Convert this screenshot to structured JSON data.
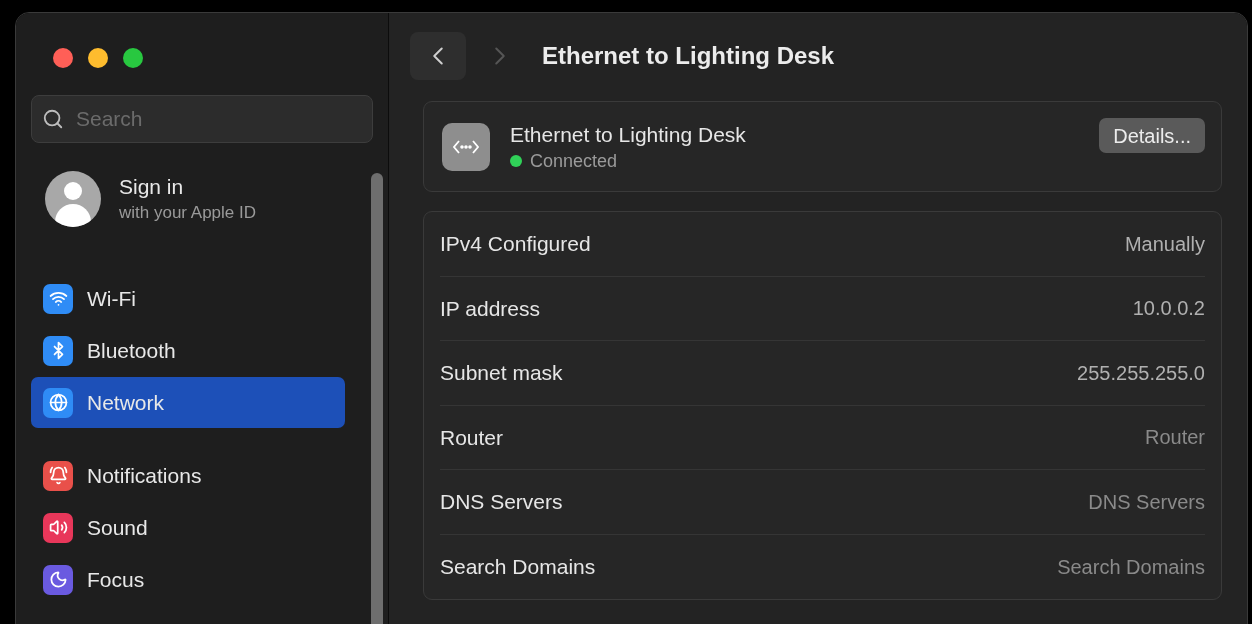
{
  "sidebar": {
    "search": {
      "placeholder": "Search"
    },
    "account": {
      "title": "Sign in",
      "subtitle": "with your Apple ID"
    },
    "groups": [
      [
        {
          "label": "Wi-Fi",
          "kind": "wifi",
          "selected": false
        },
        {
          "label": "Bluetooth",
          "kind": "bluetooth",
          "selected": false
        },
        {
          "label": "Network",
          "kind": "network",
          "selected": true
        }
      ],
      [
        {
          "label": "Notifications",
          "kind": "notifications",
          "selected": false
        },
        {
          "label": "Sound",
          "kind": "sound",
          "selected": false
        },
        {
          "label": "Focus",
          "kind": "focus",
          "selected": false
        }
      ]
    ]
  },
  "header": {
    "title": "Ethernet to Lighting Desk",
    "back_enabled": true,
    "forward_enabled": false
  },
  "connection": {
    "name": "Ethernet to Lighting Desk",
    "status": "Connected",
    "color": "#30d158",
    "button": "Details..."
  },
  "settings": [
    {
      "label": "IPv4 Configured",
      "value": "Manually",
      "dimmed": false
    },
    {
      "label": "IP address",
      "value": "10.0.0.2",
      "dimmed": false
    },
    {
      "label": "Subnet mask",
      "value": "255.255.255.0",
      "dimmed": false
    },
    {
      "label": "Router",
      "value": "Router",
      "dimmed": true
    },
    {
      "label": "DNS Servers",
      "value": "DNS Servers",
      "dimmed": true
    },
    {
      "label": "Search Domains",
      "value": "Search Domains",
      "dimmed": true
    }
  ]
}
